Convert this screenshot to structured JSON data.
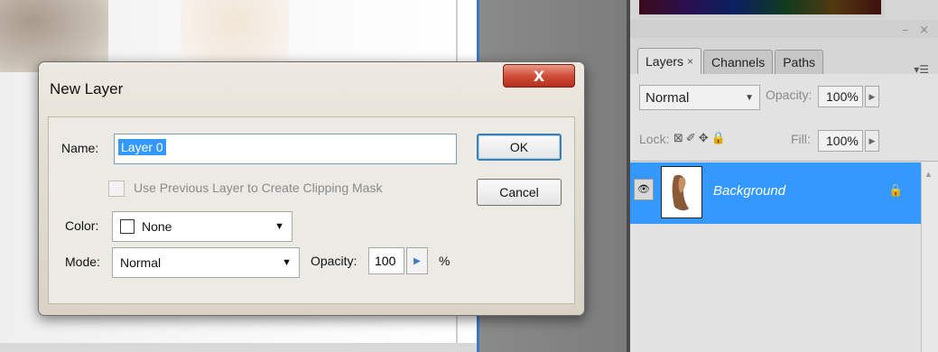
{
  "dialog": {
    "title": "New Layer",
    "close_label": "X",
    "name_label": "Name:",
    "name_value": "Layer 0",
    "ok_label": "OK",
    "cancel_label": "Cancel",
    "clipping_label": "Use Previous Layer to Create Clipping Mask",
    "clipping_checked": false,
    "color_label": "Color:",
    "color_value": "None",
    "mode_label": "Mode:",
    "mode_value": "Normal",
    "opacity_label": "Opacity:",
    "opacity_value": "100",
    "opacity_unit": "%"
  },
  "layers_panel": {
    "tabs": [
      {
        "label": "Layers",
        "close": "×"
      },
      {
        "label": "Channels"
      },
      {
        "label": "Paths"
      }
    ],
    "blend_mode": "Normal",
    "opacity_label": "Opacity:",
    "opacity_value": "100%",
    "lock_label": "Lock:",
    "fill_label": "Fill:",
    "fill_value": "100%",
    "layers": [
      {
        "name": "Background",
        "visible": true,
        "locked": true
      }
    ]
  },
  "colors": {
    "selection_blue": "#3399ff",
    "close_red": "#cf4f3a",
    "default_button_border": "#3c7fb1"
  },
  "icons": {
    "visibility": "eye-icon",
    "lock": "lock-icon",
    "panel_menu": "panel-menu-icon",
    "close": "close-icon"
  }
}
